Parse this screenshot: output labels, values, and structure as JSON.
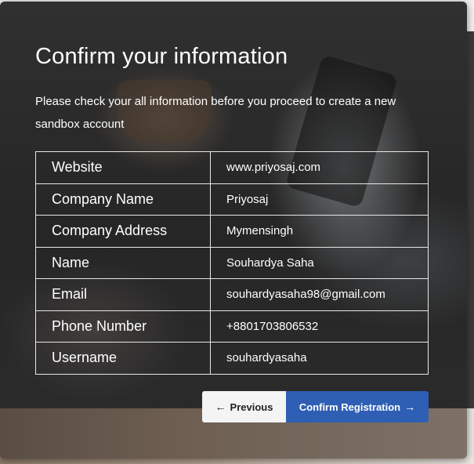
{
  "modal": {
    "title": "Confirm your information",
    "subtitle": "Please check your all information before you proceed to create a new sandbox account"
  },
  "details": [
    {
      "label": "Website",
      "value": "www.priyosaj.com"
    },
    {
      "label": "Company Name",
      "value": "Priyosaj"
    },
    {
      "label": "Company Address",
      "value": "Mymensingh"
    },
    {
      "label": "Name",
      "value": "Souhardya Saha"
    },
    {
      "label": "Email",
      "value": "souhardyasaha98@gmail.com"
    },
    {
      "label": "Phone Number",
      "value": "+8801703806532"
    },
    {
      "label": "Username",
      "value": "souhardyasaha"
    }
  ],
  "buttons": {
    "previous_label": "Previous",
    "previous_icon": "arrow-left-icon",
    "confirm_label": "Confirm Registration",
    "confirm_icon": "arrow-right-icon",
    "confirm_color": "#2e5fb4",
    "previous_color": "#f4f4f4"
  }
}
